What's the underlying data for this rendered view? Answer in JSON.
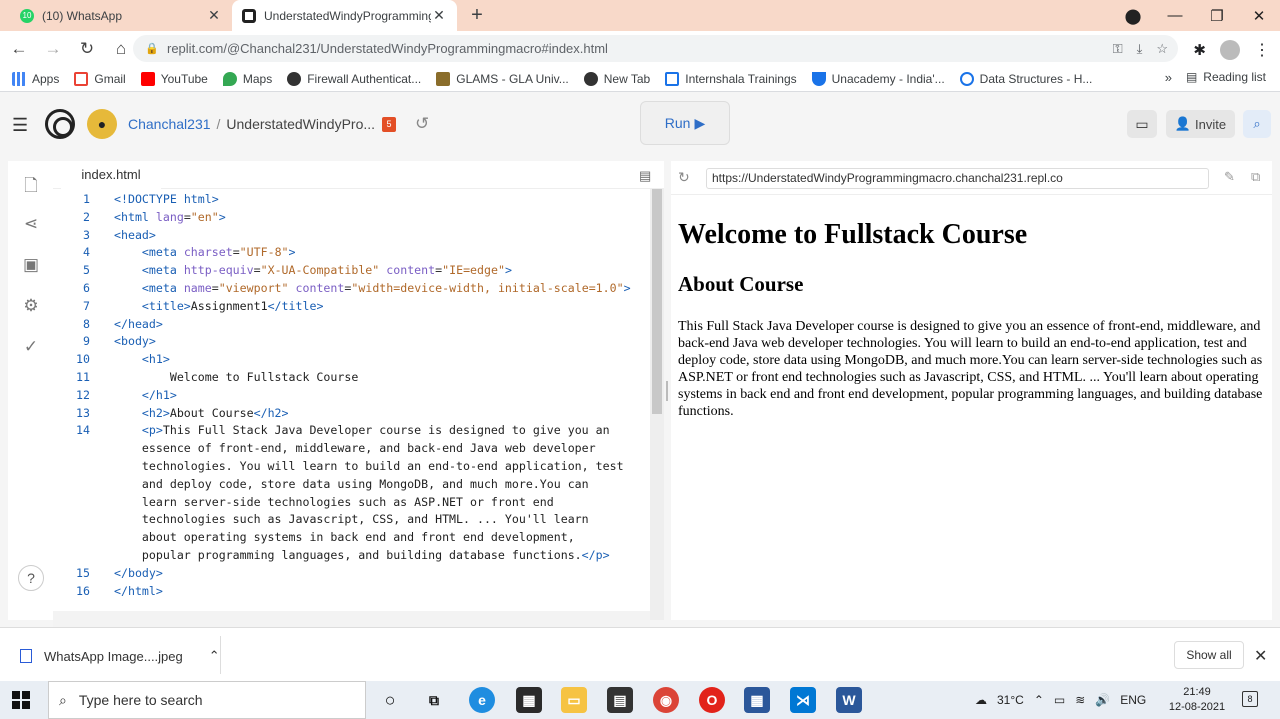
{
  "browser": {
    "tabs": [
      {
        "title": "(10) WhatsApp",
        "badge": "10",
        "active": false
      },
      {
        "title": "UnderstatedWindyProgrammingmacro",
        "active": true
      }
    ],
    "url": "replit.com/@Chanchal231/UnderstatedWindyProgrammingmacro#index.html",
    "bookmarks": [
      "Apps",
      "Gmail",
      "YouTube",
      "Maps",
      "Firewall Authenticat...",
      "GLAMS - GLA Univ...",
      "New Tab",
      "Internshala Trainings",
      "Unacademy - India'...",
      "Data Structures - H..."
    ],
    "bookmarks_more": "»",
    "reading_list": "Reading list"
  },
  "replit": {
    "username": "Chanchal231",
    "separator": "/",
    "repl_name": "UnderstatedWindyPro...",
    "run_label": "Run",
    "invite_label": "Invite",
    "help_label": "?"
  },
  "editor": {
    "file_tab": "index.html",
    "lines": [
      {
        "n": "1",
        "html": "<span class='tag'>&lt;!DOCTYPE</span> <span class='tag'>html</span><span class='tag'>&gt;</span>"
      },
      {
        "n": "2",
        "html": "<span class='tag'>&lt;html</span> <span class='attr'>lang</span>=<span class='str'>\"en\"</span><span class='tag'>&gt;</span>"
      },
      {
        "n": "3",
        "html": "<span class='tag'>&lt;head&gt;</span>"
      },
      {
        "n": "4",
        "html": "    <span class='tag'>&lt;meta</span> <span class='attr'>charset</span>=<span class='str'>\"UTF-8\"</span><span class='tag'>&gt;</span>"
      },
      {
        "n": "5",
        "html": "    <span class='tag'>&lt;meta</span> <span class='attr'>http-equiv</span>=<span class='str'>\"X-UA-Compatible\"</span> <span class='attr'>content</span>=<span class='str'>\"IE=edge\"</span><span class='tag'>&gt;</span>"
      },
      {
        "n": "6",
        "html": "    <span class='tag'>&lt;meta</span> <span class='attr'>name</span>=<span class='str'>\"viewport\"</span> <span class='attr'>content</span>=<span class='str'>\"width=device-width, initial-scale=1.0\"</span><span class='tag'>&gt;</span>"
      },
      {
        "n": "7",
        "html": "    <span class='tag'>&lt;title&gt;</span><span class='txt'>Assignment1</span><span class='tag'>&lt;/title&gt;</span>"
      },
      {
        "n": "8",
        "html": "<span class='tag'>&lt;/head&gt;</span>"
      },
      {
        "n": "9",
        "html": "<span class='tag'>&lt;body&gt;</span>"
      },
      {
        "n": "10",
        "html": "    <span class='tag'>&lt;h1&gt;</span>"
      },
      {
        "n": "11",
        "html": "        <span class='txt'>Welcome to Fullstack Course</span>"
      },
      {
        "n": "12",
        "html": "    <span class='tag'>&lt;/h1&gt;</span>"
      },
      {
        "n": "13",
        "html": "    <span class='tag'>&lt;h2&gt;</span><span class='txt'>About Course</span><span class='tag'>&lt;/h2&gt;</span>"
      },
      {
        "n": "14",
        "html": "    <span class='tag'>&lt;p&gt;</span><span class='txt'>This Full Stack Java Developer course is designed to give you an</span>"
      },
      {
        "n": "",
        "html": "    <span class='txt'>essence of front-end, middleware, and back-end Java web developer</span>"
      },
      {
        "n": "",
        "html": "    <span class='txt'>technologies. You will learn to build an end-to-end application, test</span>"
      },
      {
        "n": "",
        "html": "    <span class='txt'>and deploy code, store data using MongoDB, and much more.You can</span>"
      },
      {
        "n": "",
        "html": "    <span class='txt'>learn server-side technologies such as ASP.NET or front end</span>"
      },
      {
        "n": "",
        "html": "    <span class='txt'>technologies such as Javascript, CSS, and HTML. ... You'll learn</span>"
      },
      {
        "n": "",
        "html": "    <span class='txt'>about operating systems in back end and front end development,</span>"
      },
      {
        "n": "",
        "html": "    <span class='txt'>popular programming languages, and building database functions.</span><span class='tag'>&lt;/p&gt;</span>"
      },
      {
        "n": "15",
        "html": "<span class='tag'>&lt;/body&gt;</span>"
      },
      {
        "n": "16",
        "html": "<span class='tag'>&lt;/html&gt;</span>"
      }
    ]
  },
  "preview": {
    "url": "https://UnderstatedWindyProgrammingmacro.chanchal231.repl.co",
    "h1": "Welcome to Fullstack Course",
    "h2": "About Course",
    "p": "This Full Stack Java Developer course is designed to give you an essence of front-end, middleware, and back-end Java web developer technologies. You will learn to build an end-to-end application, test and deploy code, store data using MongoDB, and much more.You can learn server-side technologies such as ASP.NET or front end technologies such as Javascript, CSS, and HTML. ... You'll learn about operating systems in back end and front end development, popular programming languages, and building database functions."
  },
  "downloads": {
    "file": "WhatsApp Image....jpeg",
    "show_all": "Show all"
  },
  "taskbar": {
    "search_placeholder": "Type here to search",
    "temperature": "31°C",
    "language": "ENG",
    "time": "21:49",
    "date": "12-08-2021",
    "notifications": "8"
  }
}
